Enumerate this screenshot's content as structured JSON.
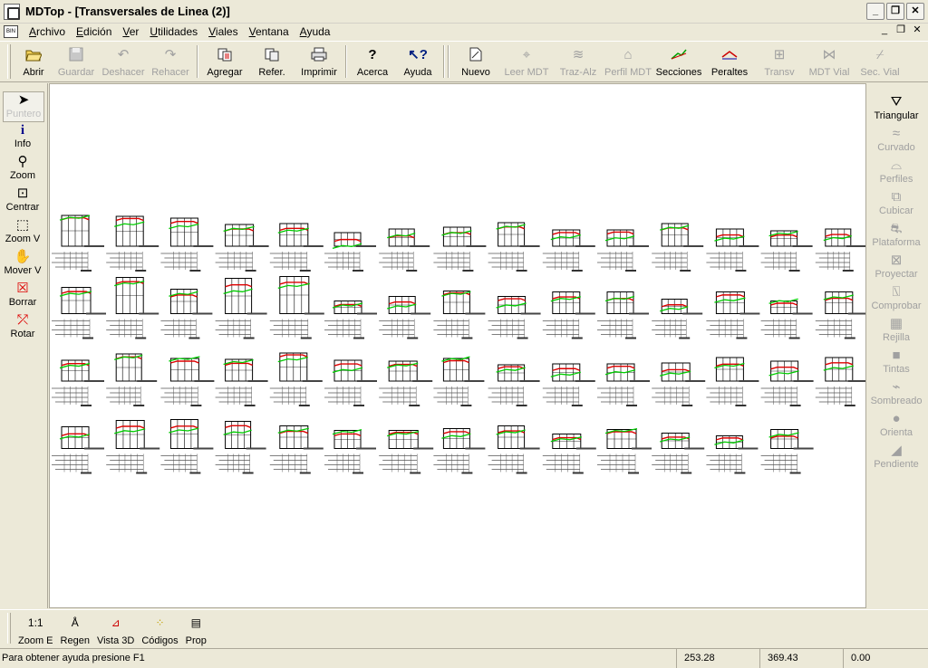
{
  "window": {
    "title": "MDTop - [Transversales de Linea (2)]",
    "controls": [
      "_",
      "❐",
      "✕"
    ]
  },
  "menu": {
    "items": [
      "Archivo",
      "Edición",
      "Ver",
      "Utilidades",
      "Viales",
      "Ventana",
      "Ayuda"
    ],
    "mdi_controls": [
      "_",
      "❐",
      "✕"
    ]
  },
  "toolbar": {
    "buttons": [
      {
        "label": "Abrir",
        "icon": "folder-open-icon",
        "enabled": true
      },
      {
        "label": "Guardar",
        "icon": "save-icon",
        "enabled": false
      },
      {
        "label": "Deshacer",
        "icon": "undo-icon",
        "enabled": false
      },
      {
        "label": "Rehacer",
        "icon": "redo-icon",
        "enabled": false
      },
      {
        "label": "Agregar",
        "icon": "add-icon",
        "enabled": true
      },
      {
        "label": "Refer.",
        "icon": "reference-icon",
        "enabled": true
      },
      {
        "label": "Imprimir",
        "icon": "print-icon",
        "enabled": true
      },
      {
        "label": "Acerca",
        "icon": "about-icon",
        "enabled": true
      },
      {
        "label": "Ayuda",
        "icon": "help-icon",
        "enabled": true
      },
      {
        "label": "Nuevo",
        "icon": "new-icon",
        "enabled": true
      },
      {
        "label": "Leer MDT",
        "icon": "read-mdt-icon",
        "enabled": false
      },
      {
        "label": "Traz-Alz",
        "icon": "traz-alz-icon",
        "enabled": false
      },
      {
        "label": "Perfil MDT",
        "icon": "profile-mdt-icon",
        "enabled": false
      },
      {
        "label": "Secciones",
        "icon": "sections-icon",
        "enabled": true
      },
      {
        "label": "Peraltes",
        "icon": "superelevation-icon",
        "enabled": true
      },
      {
        "label": "Transv",
        "icon": "transverse-icon",
        "enabled": false
      },
      {
        "label": "MDT Vial",
        "icon": "mdt-road-icon",
        "enabled": false
      },
      {
        "label": "Sec. Vial",
        "icon": "road-section-icon",
        "enabled": false
      }
    ]
  },
  "left_tools": [
    {
      "label": "Puntero",
      "icon": "pointer-icon",
      "active": true
    },
    {
      "label": "Info",
      "icon": "info-icon",
      "active": false
    },
    {
      "label": "Zoom",
      "icon": "zoom-icon",
      "active": false
    },
    {
      "label": "Centrar",
      "icon": "center-icon",
      "active": false
    },
    {
      "label": "Zoom V",
      "icon": "zoom-window-icon",
      "active": false
    },
    {
      "label": "Mover V",
      "icon": "pan-hand-icon",
      "active": false
    },
    {
      "label": "Borrar",
      "icon": "erase-icon",
      "active": false
    },
    {
      "label": "Rotar",
      "icon": "rotate-icon",
      "active": false
    }
  ],
  "right_tools": [
    {
      "label": "Triangular",
      "icon": "triangulate-icon",
      "enabled": true
    },
    {
      "label": "Curvado",
      "icon": "contour-icon",
      "enabled": false
    },
    {
      "label": "Perfiles",
      "icon": "profiles-icon",
      "enabled": false
    },
    {
      "label": "Cubicar",
      "icon": "volume-icon",
      "enabled": false
    },
    {
      "label": "Plataforma",
      "icon": "platform-icon",
      "enabled": false
    },
    {
      "label": "Proyectar",
      "icon": "project-icon",
      "enabled": false
    },
    {
      "label": "Comprobar",
      "icon": "check-icon",
      "enabled": false
    },
    {
      "label": "Rejilla",
      "icon": "grid-icon",
      "enabled": false
    },
    {
      "label": "Tintas",
      "icon": "inks-icon",
      "enabled": false
    },
    {
      "label": "Sombreado",
      "icon": "shading-icon",
      "enabled": false
    },
    {
      "label": "Orienta",
      "icon": "orient-icon",
      "enabled": false
    },
    {
      "label": "Pendiente",
      "icon": "slope-icon",
      "enabled": false
    }
  ],
  "bottom_tools": [
    {
      "label": "Zoom E",
      "icon_text": "1:1",
      "icon": "scale-icon"
    },
    {
      "label": "Regen",
      "icon_text": "",
      "icon": "regen-icon"
    },
    {
      "label": "Vista 3D",
      "icon_text": "",
      "icon": "view3d-icon"
    },
    {
      "label": "Códigos",
      "icon_text": "",
      "icon": "codes-icon"
    },
    {
      "label": "Prop",
      "icon_text": "",
      "icon": "properties-icon"
    }
  ],
  "drawing": {
    "rows": 4,
    "sections_per_row": [
      15,
      15,
      15,
      14
    ],
    "colors": {
      "grid": "#000000",
      "terrain": "#00cc00",
      "design": "#dd0000",
      "dim": "#555555"
    }
  },
  "status": {
    "message": "Para obtener ayuda presione F1",
    "x": "253.28",
    "y": "369.43",
    "z": "0.00"
  }
}
